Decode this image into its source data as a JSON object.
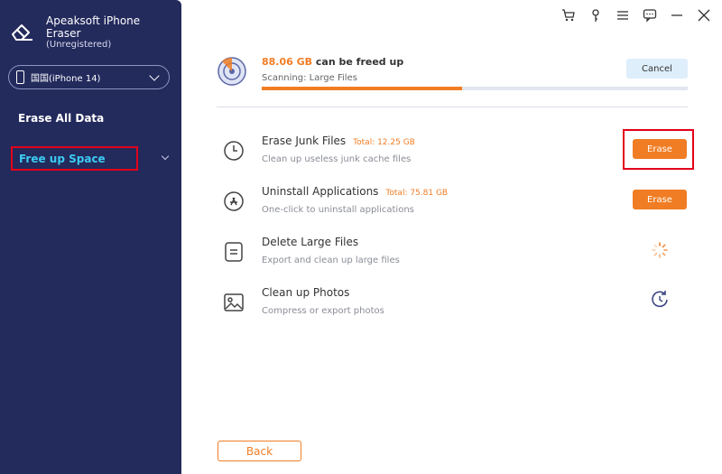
{
  "app": {
    "title": "Apeaksoft iPhone Eraser",
    "subtitle": "(Unregistered)"
  },
  "device": {
    "selected": "国国(iPhone 14)"
  },
  "nav": {
    "erase_all": "Erase All Data",
    "free_up": "Free up Space"
  },
  "titlebar_icons": [
    "cart-icon",
    "key-icon",
    "menu-icon",
    "feedback-icon",
    "minimize-icon",
    "close-icon"
  ],
  "scan": {
    "amount": "88.06 GB",
    "amount_suffix": "can be freed up",
    "status": "Scanning: Large Files",
    "progress": 0.47,
    "cancel_label": "Cancel"
  },
  "items": [
    {
      "title": "Erase Junk Files",
      "total": "Total: 12.25 GB",
      "desc": "Clean up useless junk cache files",
      "action": "Erase",
      "icon": "clock-icon"
    },
    {
      "title": "Uninstall Applications",
      "total": "Total: 75.81 GB",
      "desc": "One-click to uninstall applications",
      "action": "Erase",
      "icon": "app-store-icon"
    },
    {
      "title": "Delete Large Files",
      "total": "",
      "desc": "Export and clean up large files",
      "status_icon": "loading-spinner-icon",
      "icon": "document-icon"
    },
    {
      "title": "Clean up Photos",
      "total": "",
      "desc": "Compress or export photos",
      "status_icon": "refresh-icon",
      "icon": "photo-icon"
    }
  ],
  "back_label": "Back",
  "colors": {
    "sidebar": "#232a5c",
    "accent": "#f07d24",
    "active_nav": "#3ccbf2",
    "highlight": "#e3001b"
  }
}
